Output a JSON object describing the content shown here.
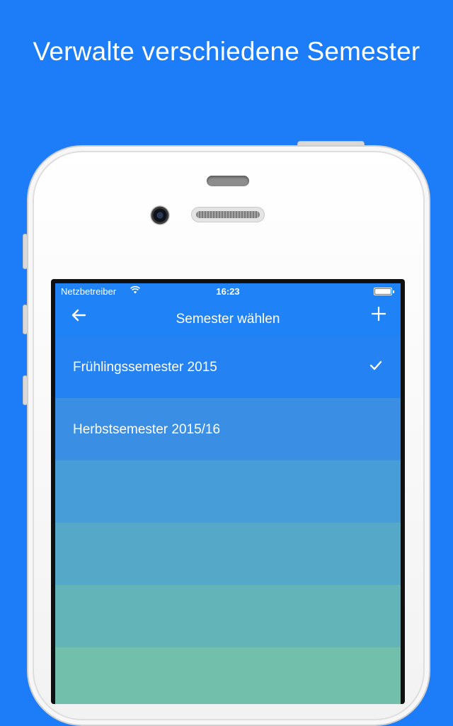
{
  "promo": {
    "title": "Verwalte verschiedene Semester"
  },
  "status_bar": {
    "carrier": "Netzbetreiber",
    "time": "16:23"
  },
  "nav": {
    "title": "Semester wählen",
    "back_icon": "arrow-left-icon",
    "add_icon": "plus-icon"
  },
  "semesters": [
    {
      "label": "Frühlingssemester 2015",
      "selected": true,
      "color": "#2582f2"
    },
    {
      "label": "Herbstsemester 2015/16",
      "selected": false,
      "color": "#3a8fe4"
    },
    {
      "label": "",
      "selected": false,
      "color": "#469dd8"
    },
    {
      "label": "",
      "selected": false,
      "color": "#55a8c8"
    },
    {
      "label": "",
      "selected": false,
      "color": "#62b4b9"
    },
    {
      "label": "",
      "selected": false,
      "color": "#72c0ab"
    }
  ],
  "colors": {
    "background": "#1d7df8",
    "accent": "#1f82f7"
  }
}
